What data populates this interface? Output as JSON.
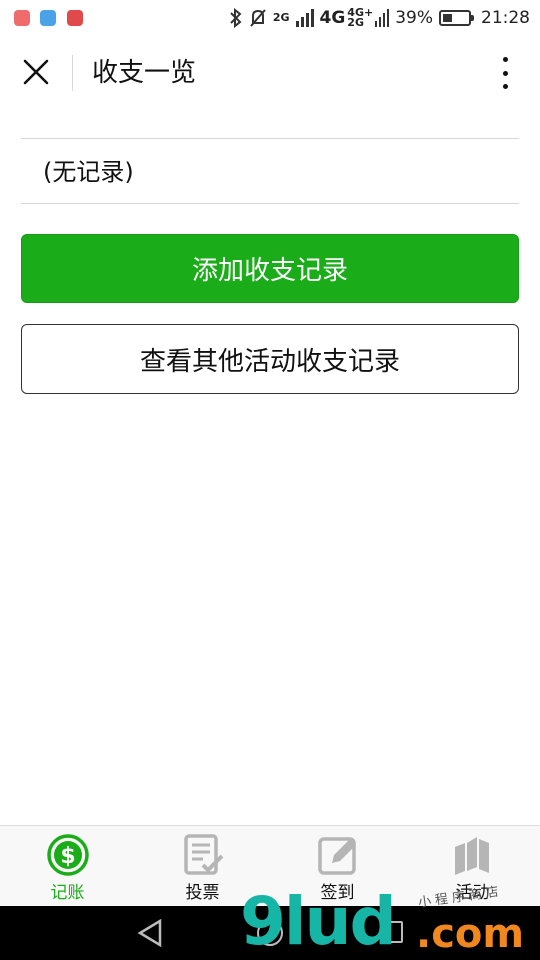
{
  "status_bar": {
    "apps": [
      {
        "icon": "notification-app-icon-1",
        "color": "#f06b6b"
      },
      {
        "icon": "notification-app-icon-2",
        "color": "#4aa3e8"
      },
      {
        "icon": "notification-app-icon-3",
        "color": "#e04a4a"
      }
    ],
    "network_1": "2G",
    "network_2_top": "4G",
    "network_2_bottom": "4G+",
    "network_3": "2G",
    "battery_percent": "39%",
    "battery_level": 0.39,
    "time": "21:28"
  },
  "header": {
    "title": "收支一览",
    "close_icon": "close-icon",
    "more_icon": "more-vertical-icon"
  },
  "records": {
    "empty_text": "(无记录)"
  },
  "actions": {
    "add_label": "添加收支记录",
    "other_label": "查看其他活动收支记录"
  },
  "tabs": [
    {
      "label": "记账",
      "icon": "dollar-coin-icon",
      "active": true
    },
    {
      "label": "投票",
      "icon": "vote-checklist-icon",
      "active": false
    },
    {
      "label": "签到",
      "icon": "checkin-edit-icon",
      "active": false
    },
    {
      "label": "活动",
      "icon": "activity-books-icon",
      "active": false
    }
  ],
  "watermark": {
    "main": "9lud",
    "suffix": ".com",
    "small": "小程序商店"
  },
  "colors": {
    "primary": "#1aad19",
    "inactive_icon": "#b5b5b5",
    "tabbar_bg": "#f8f8f8",
    "logo_teal": "#17b5a6",
    "logo_orange": "#f1881f"
  }
}
